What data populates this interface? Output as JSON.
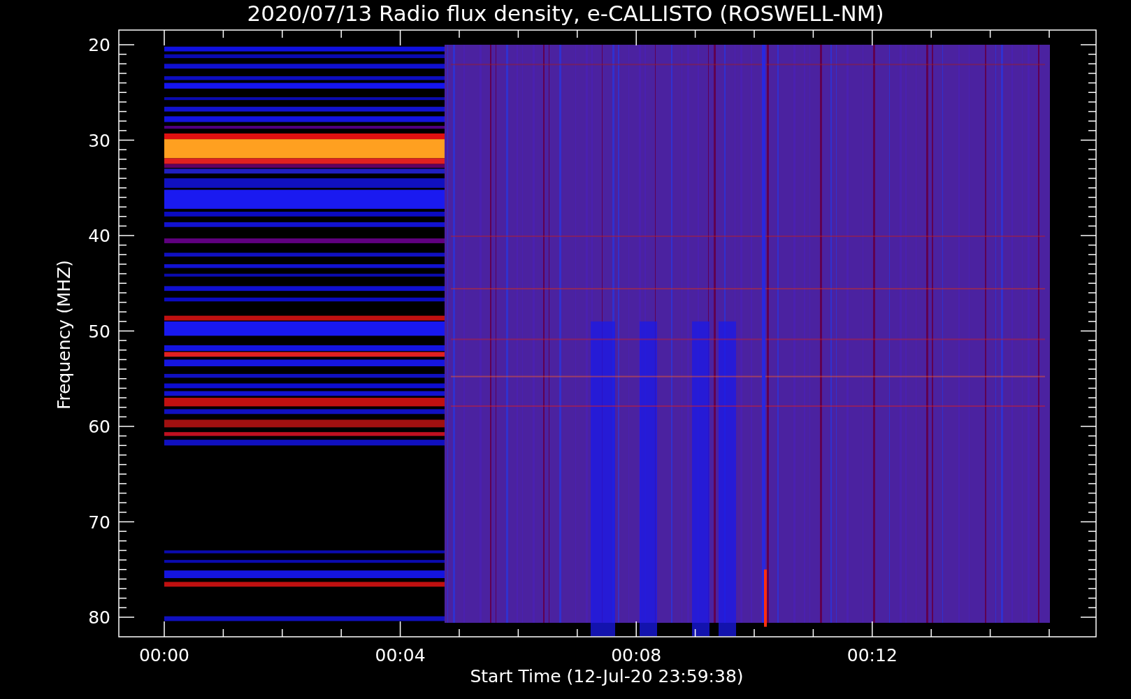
{
  "title": "2020/07/13  Radio flux density, e-CALLISTO (ROSWELL-NM)",
  "y_axis": {
    "label": "Frequency (MHZ)",
    "ticks": [
      "20",
      "30",
      "40",
      "50",
      "60",
      "70",
      "80"
    ]
  },
  "x_axis": {
    "label": "Start Time (12-Jul-20 23:59:38)",
    "ticks": [
      "00:00",
      "00:04",
      "00:08",
      "00:12"
    ]
  }
}
